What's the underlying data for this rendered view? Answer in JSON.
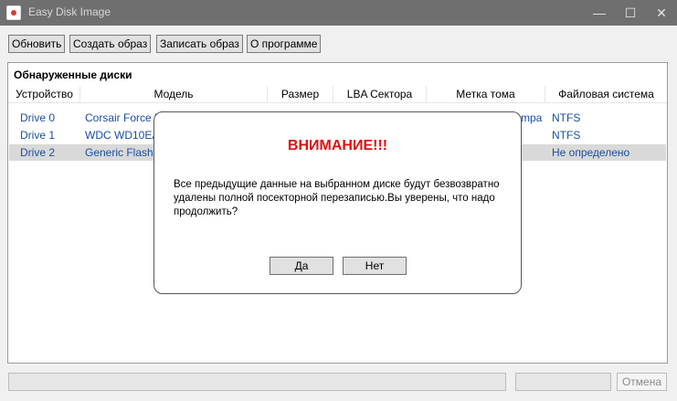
{
  "window": {
    "title": "Easy Disk Image"
  },
  "toolbar": {
    "refresh": "Обновить",
    "create_image": "Создать образ",
    "write_image": "Записать образ",
    "about": "О программе"
  },
  "disks": {
    "group_title": "Обнаруженные диски",
    "columns": [
      "Устройство",
      "Модель",
      "Размер",
      "LBA Сектора",
      "Метка тома",
      "Файловая система"
    ],
    "rows": [
      {
        "device": "Drive 0",
        "model": "Corsair Force L",
        "label_fragment": "mpa",
        "fs": "NTFS"
      },
      {
        "device": "Drive 1",
        "model": "WDC WD10EA",
        "label_fragment": "",
        "fs": "NTFS"
      },
      {
        "device": "Drive 2",
        "model": "Generic Flash D",
        "label_fragment": "",
        "fs": "Не определено"
      }
    ]
  },
  "dialog": {
    "title": "ВНИМАНИЕ!!!",
    "message": "Все предыдущие данные на выбранном диске будут безвозвратно удалены полной посекторной перезаписью.Вы уверены, что надо продолжить?",
    "yes": "Да",
    "no": "Нет"
  },
  "status": {
    "cancel": "Отмена"
  },
  "colors": {
    "accent_text": "#1a4ea5",
    "warning": "#e01010",
    "titlebar": "#6f6f6f"
  }
}
